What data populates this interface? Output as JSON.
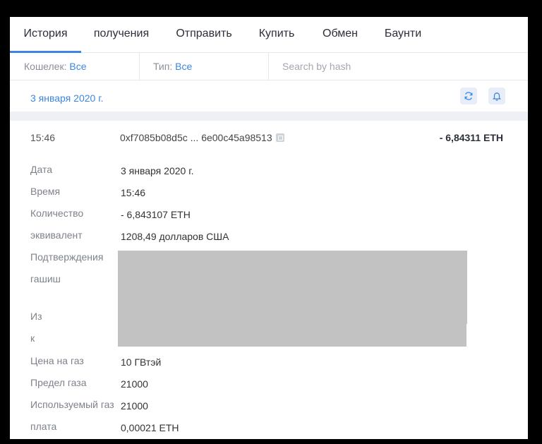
{
  "tabs": [
    {
      "label": "История",
      "active": true
    },
    {
      "label": "получения"
    },
    {
      "label": "Отправить"
    },
    {
      "label": "Купить"
    },
    {
      "label": "Обмен"
    },
    {
      "label": "Баунти"
    }
  ],
  "filters": {
    "wallet_label": "Кошелек:",
    "wallet_value": "Все",
    "type_label": "Тип:",
    "type_value": "Все",
    "search_placeholder": "Search by hash"
  },
  "date_group": "3 января 2020 г.",
  "transaction": {
    "time": "15:46",
    "hash": "0xf7085b08d5c ... 6e00c45a98513",
    "amount": "- 6,84311 ETH",
    "fields": {
      "date": {
        "label": "Дата",
        "value": "3 января 2020 г."
      },
      "time": {
        "label": "Время",
        "value": "15:46"
      },
      "qty": {
        "label": "Количество",
        "value": "- 6,843107  ETH"
      },
      "equiv": {
        "label": "эквивалент",
        "value": "1208,49 долларов США"
      },
      "confirm": {
        "label": "Подтверждения"
      },
      "hash": {
        "label": "гашиш"
      },
      "from": {
        "label": "Из"
      },
      "to": {
        "label": "к"
      },
      "gasprice": {
        "label": "Цена на газ",
        "value": "10 ГВтэй"
      },
      "gaslimit": {
        "label": "Предел газа",
        "value": "21000"
      },
      "gasused": {
        "label": "Используемый газ",
        "value": "21000"
      },
      "fee": {
        "label": "плата",
        "value": "0,00021 ETH"
      }
    }
  },
  "colors": {
    "accent": "#3d86e0",
    "redaction": "#c2c2c2"
  }
}
